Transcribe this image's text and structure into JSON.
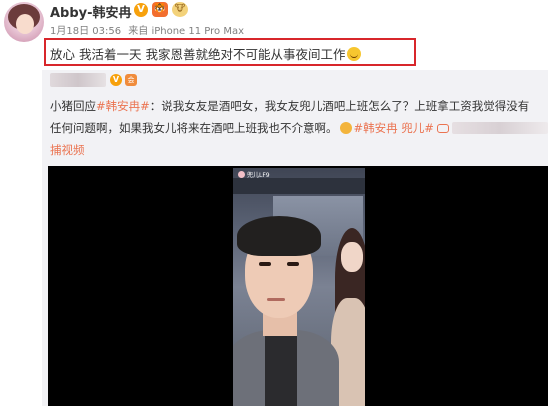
{
  "post": {
    "author": "Abby-韩安冉",
    "vip_badge": "V",
    "tag_a": "🐯",
    "tag_b": "🐮",
    "date": "1月18日 03:56",
    "source": "来自 iPhone 11 Pro Max",
    "text": "放心 我活着一天 我家恩善就绝对不可能从事夜间工作"
  },
  "repost": {
    "author_obscured": "",
    "vip_badge": "V",
    "vip_tag": "会",
    "line1_prefix": "小猪回应",
    "line1_tag": "#韩安冉#",
    "line1_rest": "：说我女友是酒吧女，我女友兜儿酒吧上班怎么了？上班拿工资我觉得没有",
    "line2_text": "任何问题啊，如果我女儿将来在酒吧上班我也不介意啊。",
    "line2_tag1": "#韩安冉",
    "line2_tag2": "兜儿#",
    "line3_text": "捕视频"
  },
  "video": {
    "overlay_name": "兜儿LF9"
  },
  "colors": {
    "accent_link": "#eb7350",
    "highlight_border": "#d8262b",
    "repost_bg": "#f2f2f5"
  }
}
